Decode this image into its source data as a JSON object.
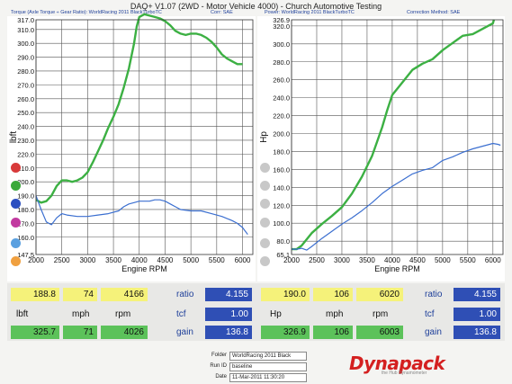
{
  "title": "DAQ+ V1.07 (2WD - Motor Vehicle 4000) - Church Automotive Testing",
  "left_header": {
    "measure": "Torque (Axle Torque ÷ Gear Ratio): WorldRacing 2011 BlackTurboTC",
    "corr": "Corr: SAE"
  },
  "right_header": {
    "measure": "Power: WorldRacing 2011 BlackTurboTC",
    "corr": "Correction Method: SAE"
  },
  "legend_dots": [
    "#d83a3a",
    "#3aa83a",
    "#2b4fc0",
    "#c23aa0",
    "#5aa0e0",
    "#f0a040"
  ],
  "right_legend_dots": [
    "#c8c8c8",
    "#c8c8c8",
    "#c8c8c8",
    "#c8c8c8",
    "#c8c8c8",
    "#c8c8c8"
  ],
  "chart_data": [
    {
      "type": "line",
      "ylabel": "lbft",
      "xlabel": "Engine RPM",
      "xlim": [
        2000,
        6200
      ],
      "ylim": [
        147.5,
        317.0
      ],
      "x_ticks": [
        "2000",
        "2500",
        "3000",
        "3500",
        "4000",
        "4500",
        "5000",
        "5500",
        "6000"
      ],
      "x_tick_values": [
        2000,
        2500,
        3000,
        3500,
        4000,
        4500,
        5000,
        5500,
        6000
      ],
      "y_ticks": [
        "147.5",
        "160.0",
        "170.0",
        "180.0",
        "190.0",
        "200.0",
        "210.0",
        "220.0",
        "230.0",
        "240.0",
        "250.0",
        "260.0",
        "270.0",
        "280.0",
        "290.0",
        "300.0",
        "310.0",
        "317.0"
      ],
      "y_tick_values": [
        147.5,
        160,
        170,
        180,
        190,
        200,
        210,
        220,
        230,
        240,
        250,
        260,
        270,
        280,
        290,
        300,
        310,
        317
      ],
      "grid": true,
      "series": [
        {
          "color": "#3cb043",
          "x": [
            2000,
            2100,
            2200,
            2300,
            2400,
            2500,
            2600,
            2700,
            2800,
            2900,
            3000,
            3100,
            3200,
            3300,
            3400,
            3500,
            3600,
            3700,
            3800,
            3900,
            3950,
            4000,
            4100,
            4200,
            4300,
            4400,
            4500,
            4600,
            4700,
            4800,
            4900,
            5000,
            5100,
            5200,
            5300,
            5400,
            5500,
            5600,
            5700,
            5800,
            5900,
            6000
          ],
          "values": [
            187,
            185,
            186,
            190,
            197,
            201,
            201,
            200,
            201,
            203,
            207,
            214,
            222,
            230,
            239,
            247,
            256,
            268,
            282,
            300,
            312,
            319,
            321,
            320,
            319,
            318,
            316,
            313,
            309,
            307,
            306,
            307,
            307,
            306,
            304,
            301,
            297,
            292,
            289,
            287,
            285,
            285
          ]
        },
        {
          "color": "#3b6fd0",
          "x": [
            2000,
            2100,
            2200,
            2300,
            2400,
            2500,
            2600,
            2800,
            3000,
            3200,
            3400,
            3600,
            3700,
            3800,
            3900,
            4000,
            4100,
            4200,
            4300,
            4400,
            4500,
            4600,
            4700,
            4800,
            5000,
            5200,
            5400,
            5600,
            5800,
            5900,
            6000,
            6100
          ],
          "values": [
            190,
            180,
            171,
            169,
            174,
            177,
            176,
            175,
            175,
            176,
            177,
            179,
            182,
            184,
            185,
            186,
            186,
            186,
            187,
            187,
            186,
            184,
            182,
            180,
            179,
            179,
            177,
            175,
            172,
            170,
            167,
            162
          ]
        }
      ]
    },
    {
      "type": "line",
      "ylabel": "Hp",
      "xlabel": "Engine RPM",
      "xlim": [
        2000,
        6200
      ],
      "ylim": [
        65.1,
        326.9
      ],
      "x_ticks": [
        "2000",
        "2500",
        "3000",
        "3500",
        "4000",
        "4500",
        "5000",
        "5500",
        "6000"
      ],
      "x_tick_values": [
        2000,
        2500,
        3000,
        3500,
        4000,
        4500,
        5000,
        5500,
        6000
      ],
      "y_ticks": [
        "65.1",
        "80.0",
        "100.0",
        "120.0",
        "140.0",
        "160.0",
        "180.0",
        "200.0",
        "220.0",
        "240.0",
        "260.0",
        "280.0",
        "300.0",
        "320.0",
        "326.9"
      ],
      "y_tick_values": [
        65.1,
        80,
        100,
        120,
        140,
        160,
        180,
        200,
        220,
        240,
        260,
        280,
        300,
        320,
        326.9
      ],
      "grid": true,
      "series": [
        {
          "color": "#3cb043",
          "x": [
            2000,
            2100,
            2200,
            2400,
            2600,
            2800,
            3000,
            3200,
            3400,
            3600,
            3700,
            3800,
            3900,
            4000,
            4200,
            4400,
            4600,
            4800,
            5000,
            5200,
            5400,
            5600,
            5800,
            6000,
            6020
          ],
          "values": [
            71,
            71,
            75,
            89,
            99,
            108,
            118,
            133,
            152,
            175,
            191,
            207,
            226,
            243,
            257,
            271,
            278,
            283,
            293,
            301,
            309,
            311,
            317,
            323,
            327
          ]
        },
        {
          "color": "#3b6fd0",
          "x": [
            2000,
            2100,
            2200,
            2300,
            2400,
            2600,
            2800,
            3000,
            3200,
            3400,
            3600,
            3800,
            4000,
            4200,
            4400,
            4600,
            4800,
            5000,
            5200,
            5400,
            5600,
            5800,
            6000,
            6100,
            6150
          ],
          "values": [
            71,
            71,
            72,
            70,
            74,
            83,
            91,
            99,
            106,
            114,
            123,
            133,
            141,
            148,
            155,
            159,
            162,
            170,
            174,
            179,
            183,
            186,
            189,
            188,
            187
          ]
        }
      ]
    }
  ],
  "readouts": {
    "left": {
      "cur_torque": "188.8",
      "cur_mph": "74",
      "cur_rpm": "4166",
      "lbl_unit": "lbft",
      "lbl_mph": "mph",
      "lbl_rpm": "rpm",
      "max_torque": "325.7",
      "max_mph": "71",
      "max_rpm": "4026",
      "ratio_lbl": "ratio",
      "ratio_val": "4.155",
      "tcf_lbl": "tcf",
      "tcf_val": "1.00",
      "gain_lbl": "gain",
      "gain_val": "136.8"
    },
    "right": {
      "cur_hp": "190.0",
      "cur_mph": "106",
      "cur_rpm": "6020",
      "lbl_unit": "Hp",
      "lbl_mph": "mph",
      "lbl_rpm": "rpm",
      "max_hp": "326.9",
      "max_mph": "106",
      "max_rpm": "6003",
      "ratio_lbl": "ratio",
      "ratio_val": "4.155",
      "tcf_lbl": "tcf",
      "tcf_val": "1.00",
      "gain_lbl": "gain",
      "gain_val": "136.8"
    }
  },
  "info": {
    "folder_lbl": "Folder",
    "folder_val": "WorldRacing 2011 Black",
    "run_lbl": "Run ID",
    "run_val": "baseline",
    "date_lbl": "Date",
    "date_val": "11-Mar-2011 11:30:20"
  },
  "logo": {
    "text": "Dynapack",
    "sub": "the Hub Dynamometer"
  }
}
